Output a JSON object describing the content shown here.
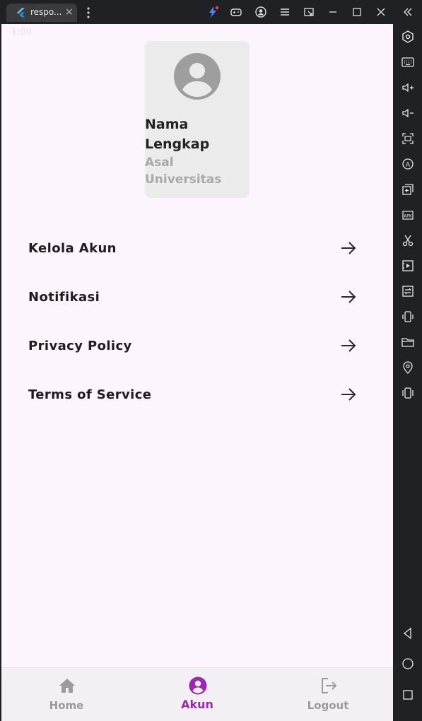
{
  "window": {
    "tab_title": "respo...",
    "tab_close": "×"
  },
  "toolbar_icons": [
    "bolt-icon",
    "gamepad-icon",
    "account-icon",
    "menu-icon",
    "resize-icon",
    "minimize-icon",
    "maximize-icon",
    "close-icon",
    "collapse-icon"
  ],
  "side_icons": [
    "settings-icon",
    "keyboard-icon",
    "volume-up-icon",
    "volume-down-icon",
    "screenshot-icon",
    "rotate-icon",
    "multi-instance-icon",
    "apk-icon",
    "cut-icon",
    "media-icon",
    "sync-icon",
    "shake-icon",
    "folder-icon",
    "location-icon",
    "vibrate-icon",
    "back-icon",
    "home-circle-icon",
    "recents-icon"
  ],
  "status": {
    "time": "1:00"
  },
  "profile": {
    "name": "Nama Lengkap",
    "university": "Asal Universitas"
  },
  "menu": [
    {
      "label": "Kelola Akun"
    },
    {
      "label": "Notifikasi"
    },
    {
      "label": "Privacy Policy"
    },
    {
      "label": "Terms of Service"
    }
  ],
  "bottom_nav": {
    "items": [
      {
        "label": "Home",
        "icon": "home-icon",
        "active": false
      },
      {
        "label": "Akun",
        "icon": "account-circle-icon",
        "active": true
      },
      {
        "label": "Logout",
        "icon": "logout-icon",
        "active": false
      }
    ]
  },
  "colors": {
    "accent": "#9c27b0",
    "background": "#fdf5fd",
    "card": "#ebebeb",
    "inactive": "#9b9b9b"
  }
}
